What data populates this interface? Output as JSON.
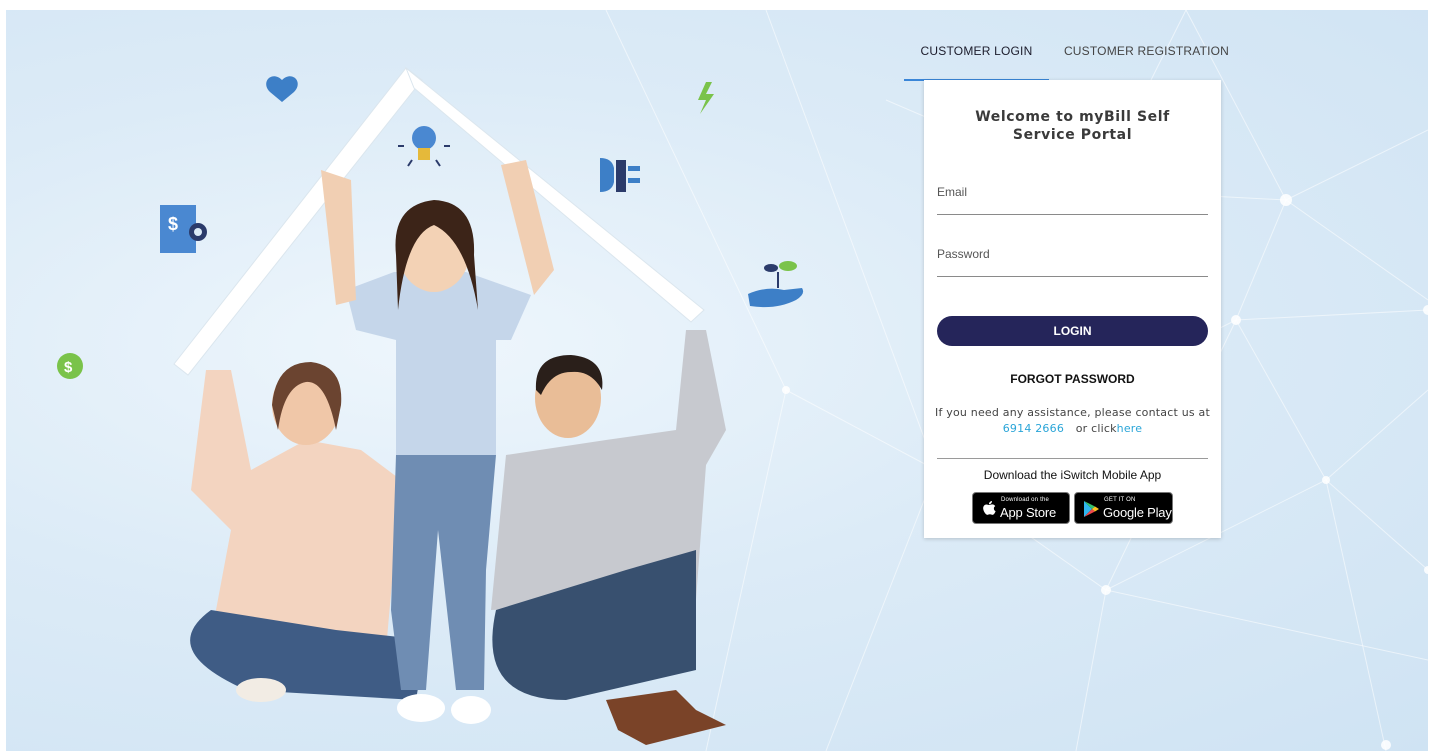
{
  "tabs": {
    "customer_login": "CUSTOMER LOGIN",
    "customer_registration": "CUSTOMER REGISTRATION"
  },
  "login_card": {
    "title": "Welcome to myBill Self Service Portal",
    "email_placeholder": "Email",
    "email_value": "",
    "password_placeholder": "Password",
    "password_value": "",
    "login_label": "LOGIN",
    "forgot_password_label": "FORGOT PASSWORD",
    "assist_text": "If you need any assistance, please contact us at",
    "phone": "6914 2666",
    "or_click": "or click",
    "here_link": "here",
    "download_text": "Download the iSwitch Mobile App"
  },
  "app_store": {
    "small": "Download on the",
    "big": "App Store"
  },
  "google_play": {
    "small": "GET IT ON",
    "big": "Google Play"
  },
  "hero": {
    "icons": [
      "heart-icon",
      "lightbulb-icon",
      "lightning-icon",
      "plug-icon",
      "document-dollar-gear-icon",
      "hand-plant-icon",
      "dollar-coin-icon"
    ]
  },
  "colors": {
    "primary_button": "#25255a",
    "tab_underline": "#3a86d8",
    "link": "#2aa5d8",
    "background": "#dcebf7"
  }
}
